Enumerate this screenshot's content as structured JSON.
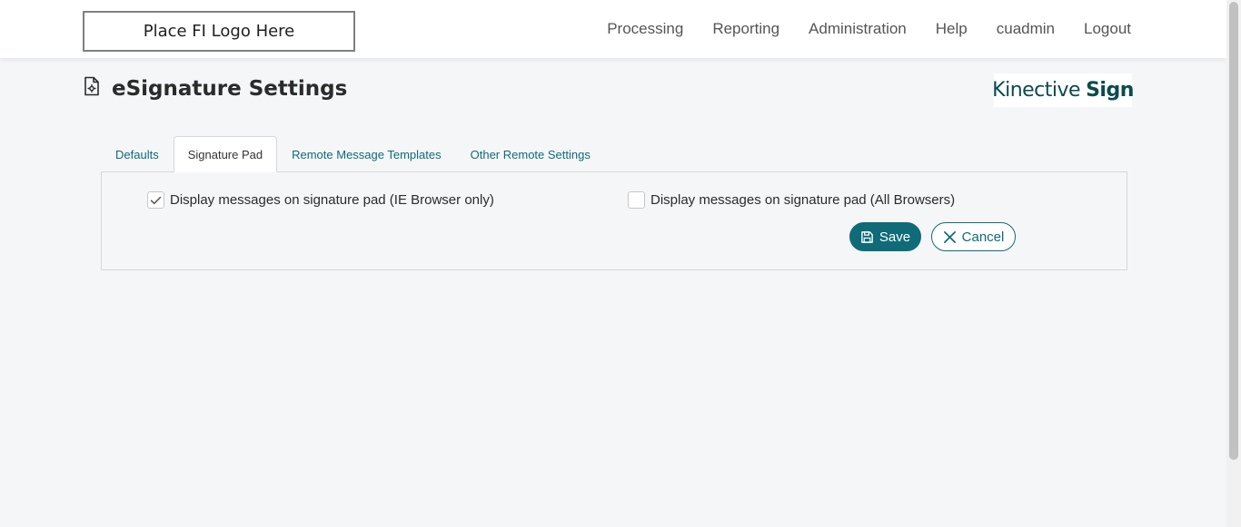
{
  "header": {
    "logo_text": "Place FI Logo Here",
    "nav": [
      "Processing",
      "Reporting",
      "Administration",
      "Help",
      "cuadmin",
      "Logout"
    ]
  },
  "page": {
    "title": "eSignature Settings",
    "title_icon": "file-settings-icon",
    "brand_light": "Kinective",
    "brand_bold": "Sign"
  },
  "tabs": [
    {
      "label": "Defaults",
      "active": false
    },
    {
      "label": "Signature Pad",
      "active": true
    },
    {
      "label": "Remote Message Templates",
      "active": false
    },
    {
      "label": "Other Remote Settings",
      "active": false
    }
  ],
  "signature_pad": {
    "option_ie": {
      "label": "Display messages on signature pad (IE Browser only)",
      "checked": true
    },
    "option_all": {
      "label": "Display messages on signature pad (All Browsers)",
      "checked": false
    }
  },
  "actions": {
    "save_label": "Save",
    "save_icon": "save-icon",
    "cancel_label": "Cancel",
    "cancel_icon": "close-icon"
  },
  "colors": {
    "accent": "#0f6b78",
    "brand": "#0c4a4f",
    "background": "#f5f6f8"
  }
}
